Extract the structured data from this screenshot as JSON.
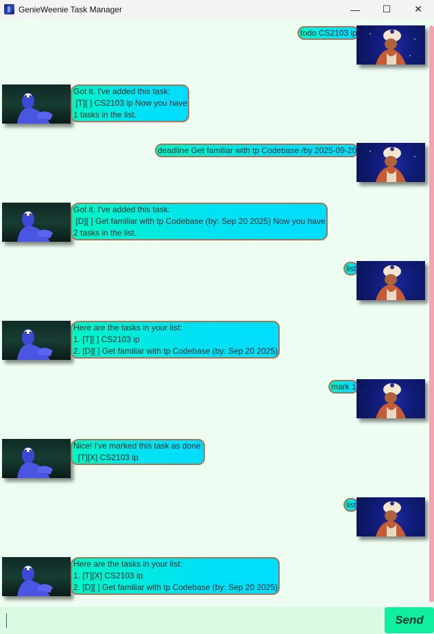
{
  "window": {
    "title": "GenieWeenie Task Manager",
    "controls": {
      "minimize": "—",
      "maximize": "☐",
      "close": "✕"
    }
  },
  "messages": [
    {
      "sender": "user",
      "text": "todo CS2103 ip"
    },
    {
      "sender": "genie",
      "text": "Got it. I've added this task:\n [T][ ] CS2103 ip Now you have\n1 tasks in the list."
    },
    {
      "sender": "user",
      "text": "deadline Get familiar with tp Codebase /by 2025-09-20"
    },
    {
      "sender": "genie",
      "text": "Got it. I've added this task:\n [D][ ] Get familiar with tp Codebase (by: Sep 20 2025) Now you have\n2 tasks in the list."
    },
    {
      "sender": "user",
      "text": "list"
    },
    {
      "sender": "genie",
      "text": "Here are the tasks in your list:\n1. [T][ ] CS2103 ip\n2. [D][ ] Get familiar with tp Codebase (by: Sep 20 2025)"
    },
    {
      "sender": "user",
      "text": "mark 1"
    },
    {
      "sender": "genie",
      "text": "Nice! I've marked this task as done:\n  [T][X] CS2103 ip"
    },
    {
      "sender": "user",
      "text": "list"
    },
    {
      "sender": "genie",
      "text": "Here are the tasks in your list:\n1. [T][X] CS2103 ip\n2. [D][ ] Get familiar with tp Codebase (by: Sep 20 2025)"
    }
  ],
  "input": {
    "value": "",
    "send_label": "Send"
  },
  "colors": {
    "background": "#eefdf2",
    "bubble_start": "#00f5c5",
    "bubble_end": "#00dcff",
    "bubble_border": "#a0785a",
    "scrollbar": "#f3a4b1",
    "send_button": "#10eea0"
  }
}
